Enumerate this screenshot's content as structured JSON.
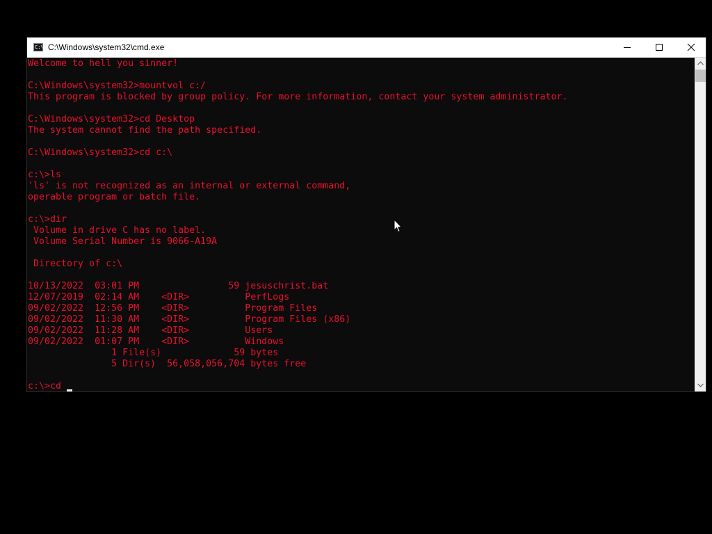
{
  "window": {
    "title": "C:\\Windows\\system32\\cmd.exe",
    "app_icon": "console-icon",
    "app_icon_glyph": "C:\\",
    "controls": [
      "minimize-icon",
      "maximize-icon",
      "close-icon"
    ]
  },
  "console": {
    "text_color": "#e8112d",
    "background_color": "#0c0c0c",
    "lines": [
      "Welcome to hell you sinner!",
      "",
      "C:\\Windows\\system32>mountvol c:/",
      "This program is blocked by group policy. For more information, contact your system administrator.",
      "",
      "C:\\Windows\\system32>cd Desktop",
      "The system cannot find the path specified.",
      "",
      "C:\\Windows\\system32>cd c:\\",
      "",
      "c:\\>ls",
      "'ls' is not recognized as an internal or external command,",
      "operable program or batch file.",
      "",
      "c:\\>dir",
      " Volume in drive C has no label.",
      " Volume Serial Number is 9066-A19A",
      "",
      " Directory of c:\\",
      "",
      "10/13/2022  03:01 PM                59 jesuschrist.bat",
      "12/07/2019  02:14 AM    <DIR>          PerfLogs",
      "09/02/2022  12:56 PM    <DIR>          Program Files",
      "09/02/2022  11:30 AM    <DIR>          Program Files (x86)",
      "09/02/2022  11:28 AM    <DIR>          Users",
      "09/02/2022  01:07 PM    <DIR>          Windows",
      "               1 File(s)             59 bytes",
      "               5 Dir(s)  56,058,056,704 bytes free",
      ""
    ],
    "prompt": "c:\\>cd ",
    "cursor_icon": "text-cursor-icon"
  },
  "scrollbar": {
    "up_icon": "scroll-up-arrow-icon",
    "down_icon": "scroll-down-arrow-icon"
  },
  "mouse_pointer_icon": "mouse-pointer-icon"
}
